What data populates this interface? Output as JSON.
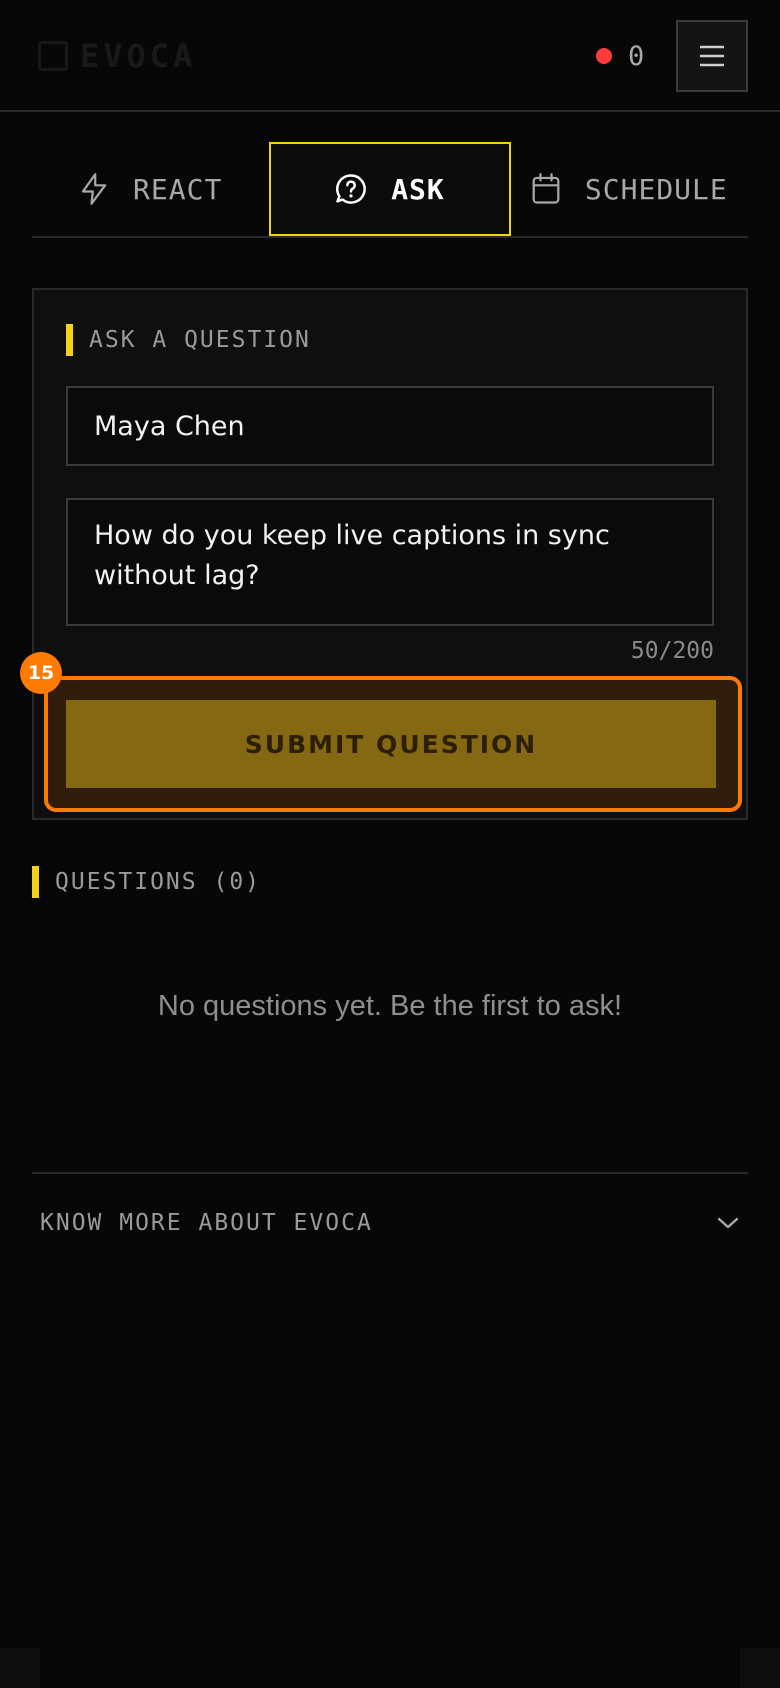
{
  "header": {
    "logo_text": "EVOCA",
    "live_count": "0",
    "colors": {
      "live_dot": "#ff3b3b"
    },
    "menu_icon": "hamburger-icon"
  },
  "tabs": [
    {
      "label": "REACT",
      "icon": "lightning-icon",
      "active": false
    },
    {
      "label": "ASK",
      "icon": "question-bubble-icon",
      "active": true
    },
    {
      "label": "SCHEDULE",
      "icon": "calendar-icon",
      "active": false
    }
  ],
  "ask": {
    "section_label": "ASK A QUESTION",
    "name_value": "Maya Chen",
    "question_value": "How do you keep live captions in sync without lag?",
    "counter": "50/200",
    "submit_label": "SUBMIT QUESTION",
    "badge": "15"
  },
  "questions": {
    "label": "QUESTIONS (0)",
    "empty_text": "No questions yet. Be the first to ask!"
  },
  "footer": {
    "know_more": "KNOW MORE ABOUT EVOCA",
    "chevron_icon": "chevron-down-icon"
  },
  "colors": {
    "accent": "#f3d31a",
    "highlight": "#ff7a00",
    "background": "#070707"
  }
}
